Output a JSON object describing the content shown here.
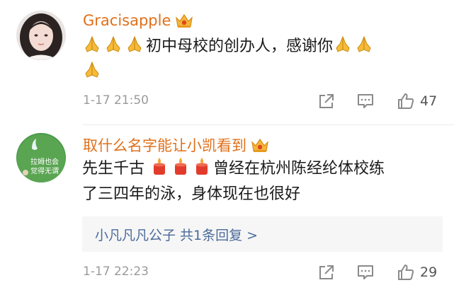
{
  "comments": [
    {
      "username": "Gracisapple",
      "text_line1_part2": "初中母校的创办人，感谢你",
      "time": "1-17 21:50",
      "likes": "47",
      "avatar_icon": "user-photo-avatar",
      "badge_icon": "crown-icon"
    },
    {
      "username": "取什么名字能让小凯看到",
      "text_part1": "先生千古",
      "text_part2": "曾经在杭州陈经纶体校练",
      "text_line2": "了三四年的泳，身体现在也很好",
      "avatar_text1": "拉姆也会",
      "avatar_text2": "觉得无谓",
      "reply_summary": "小凡凡凡公子  共1条回复 >",
      "time": "1-17 22:23",
      "likes": "29",
      "avatar_icon": "cartoon-avatar",
      "badge_icon": "crown-icon"
    }
  ],
  "colors": {
    "username": "#e0701a",
    "link": "#4b6a9b",
    "meta": "#9a9a9a"
  }
}
